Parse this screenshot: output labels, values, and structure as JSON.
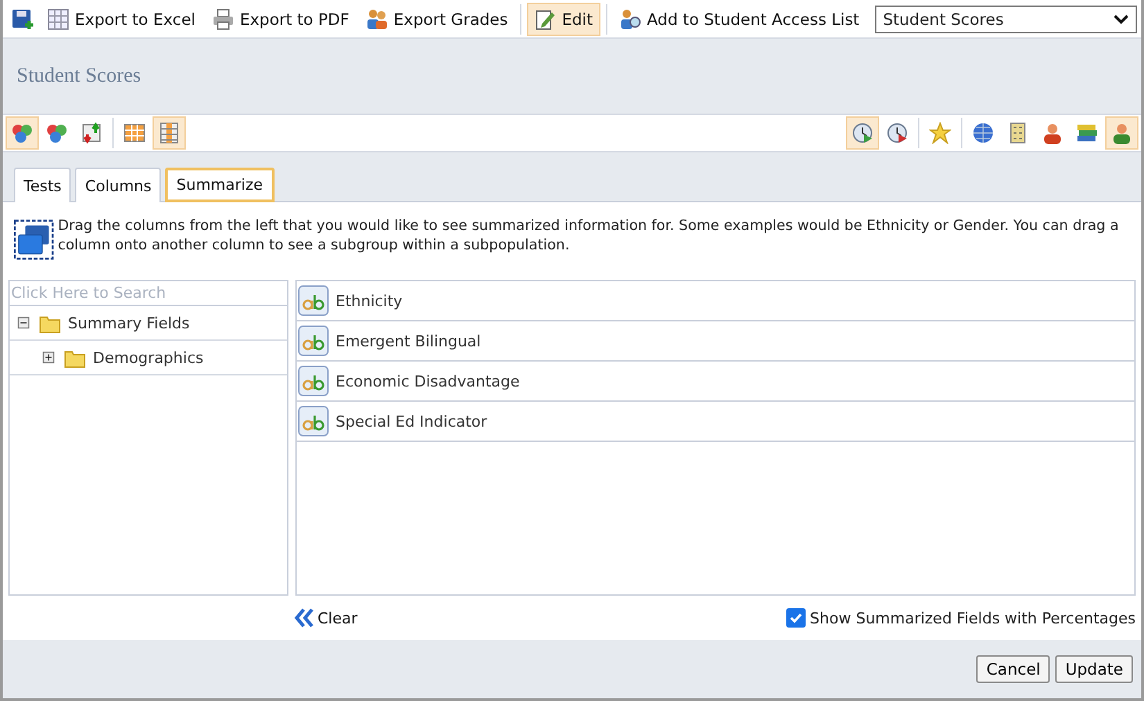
{
  "toolbar": {
    "buttons": [
      {
        "label": "Export to Excel",
        "selected": false
      },
      {
        "label": "Export to PDF",
        "selected": false
      },
      {
        "label": "Export Grades",
        "selected": false
      },
      {
        "label": "Edit",
        "selected": true
      },
      {
        "label": "Add to Student Access List",
        "selected": false
      }
    ],
    "view_select": {
      "value": "Student Scores"
    }
  },
  "page_title": "Student Scores",
  "view_tools_left": [
    {
      "selected": true
    },
    {
      "selected": false
    },
    {
      "selected": false
    },
    {
      "selected": false
    },
    {
      "selected": true
    }
  ],
  "view_tools_right": [
    {
      "selected": true
    },
    {
      "selected": false
    },
    {
      "selected": false
    },
    {
      "selected": false
    },
    {
      "selected": false
    },
    {
      "selected": false
    },
    {
      "selected": false
    },
    {
      "selected": true
    }
  ],
  "tabs": [
    {
      "label": "Tests",
      "selected": false
    },
    {
      "label": "Columns",
      "selected": false
    },
    {
      "label": "Summarize",
      "selected": true
    }
  ],
  "instructions": "Drag the columns from the left that you would like to see summarized information for. Some examples would be Ethnicity or Gender. You can drag a column onto another column to see a subgroup within a subpopulation.",
  "search": {
    "placeholder": "Click Here to Search"
  },
  "tree": [
    {
      "label": "Summary Fields",
      "expanded": true,
      "children": [
        {
          "label": "Demographics",
          "expanded": false
        }
      ]
    }
  ],
  "selected_fields": [
    "Ethnicity",
    "Emergent Bilingual",
    "Economic Disadvantage",
    "Special Ed Indicator"
  ],
  "clear_link": "Clear",
  "percentages": {
    "label": "Show Summarized Fields with Percentages",
    "checked": true
  },
  "footer_buttons": [
    "Cancel",
    "Update"
  ]
}
